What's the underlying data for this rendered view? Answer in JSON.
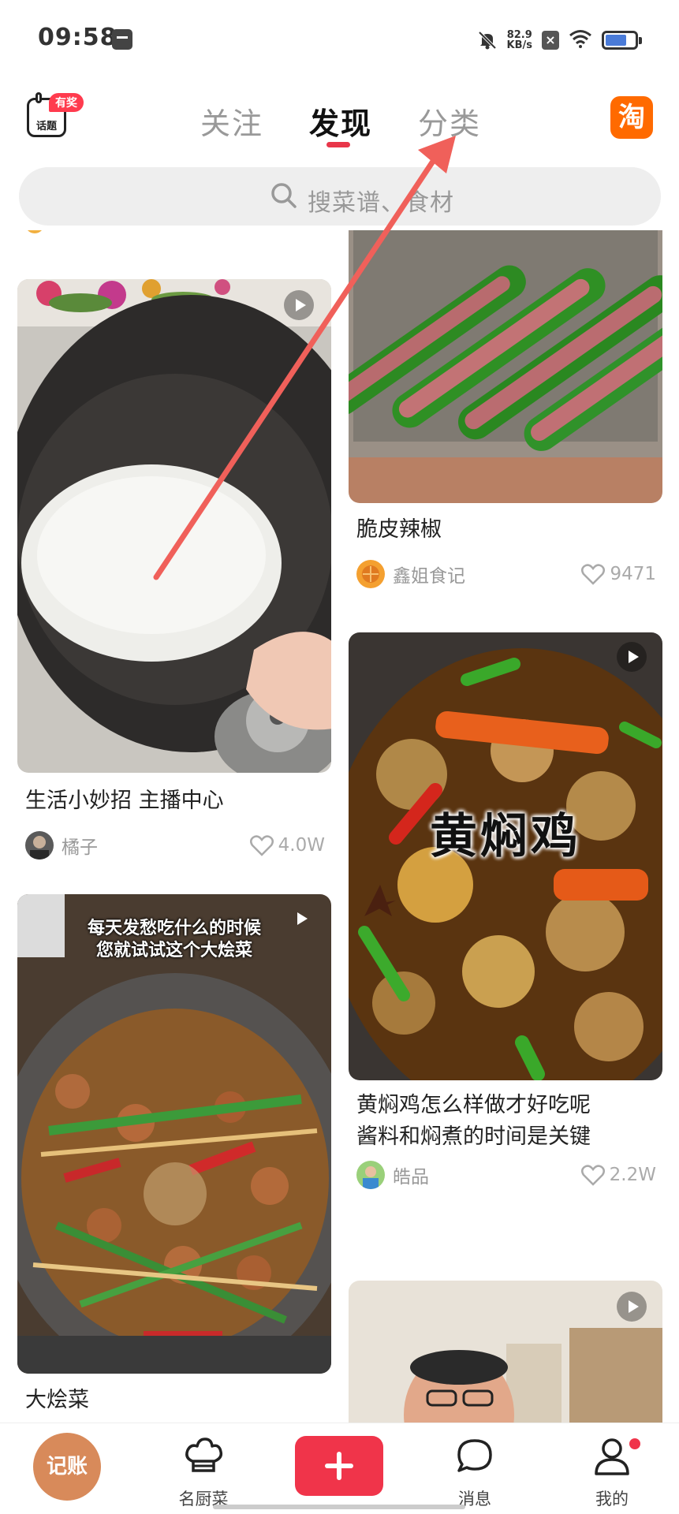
{
  "status_bar": {
    "time": "09:58",
    "net_speed_value": "82.9",
    "net_speed_unit": "KB/s",
    "battery_icon": "battery-icon",
    "wifi_icon": "wifi-icon",
    "mute_icon": "bell-muted-icon"
  },
  "header": {
    "topic_badge": "有奖",
    "topic_label": "话题",
    "tabs": [
      {
        "label": "关注",
        "active": false
      },
      {
        "label": "发现",
        "active": true
      },
      {
        "label": "分类",
        "active": false
      }
    ],
    "taobao_label": "淘"
  },
  "search": {
    "placeholder": "搜菜谱、食材"
  },
  "feed": {
    "left": [
      {
        "title": "生活小妙招 主播中心",
        "author": "橘子",
        "likes": "4.0W",
        "video": true
      },
      {
        "title": "大烩菜",
        "video": true,
        "overlay_text_line1": "每天发愁吃什么的时候",
        "overlay_text_line2": "您就试试这个大烩菜"
      }
    ],
    "right": [
      {
        "title": "脆皮辣椒",
        "author": "鑫姐食记",
        "likes": "9471"
      },
      {
        "title_line1": "黄焖鸡怎么样做才好吃呢",
        "title_line2": "酱料和焖煮的时间是关键",
        "author": "皓品",
        "likes": "2.2W",
        "video": true,
        "overlay_text": "黄焖鸡"
      },
      {
        "video": true
      }
    ]
  },
  "bottom_nav": {
    "record_label": "记账",
    "items": [
      {
        "label": "名厨菜",
        "icon": "chef-hat-icon"
      },
      {
        "label": "消息",
        "icon": "chat-bubble-icon"
      },
      {
        "label": "我的",
        "icon": "person-icon"
      }
    ]
  },
  "colors": {
    "accent": "#f0344a",
    "annotation_arrow": "#f0605a"
  }
}
